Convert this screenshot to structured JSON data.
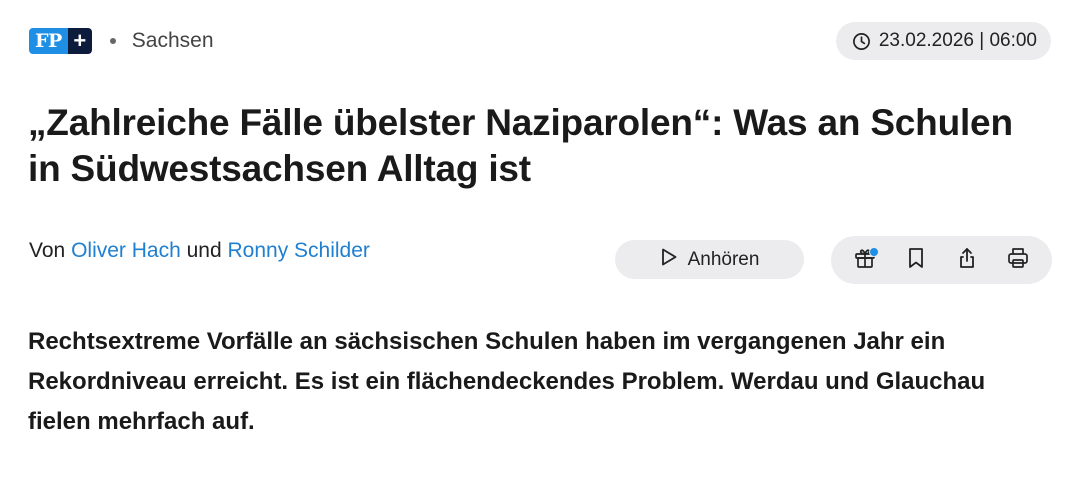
{
  "header": {
    "logo_text": "FP",
    "logo_plus": "+",
    "section": "Sachsen",
    "date": "23.02.2026 | 06:00",
    "date_icon": "clock-icon"
  },
  "article": {
    "headline": "„Zahlreiche Fälle übelster Naziparolen“: Was an Schulen in Südwestsachsen Alltag ist",
    "byline": {
      "prefix": "Von",
      "author1": "Oliver Hach",
      "conjunction": "und",
      "author2": "Ronny Schilder"
    },
    "lead": "Rechtsextreme Vorfälle an sächsischen Schulen haben im vergangenen Jahr ein Rekordniveau erreicht. Es ist ein flächendeckendes Problem. Werdau und Glauchau fielen mehrfach auf."
  },
  "actions": {
    "listen_label": "Anhören",
    "listen_icon": "play-icon",
    "icons": [
      "gift-icon",
      "bookmark-icon",
      "share-icon",
      "print-icon"
    ],
    "accent_color": "#1f8fe5",
    "link_color": "#1f7fd0"
  }
}
